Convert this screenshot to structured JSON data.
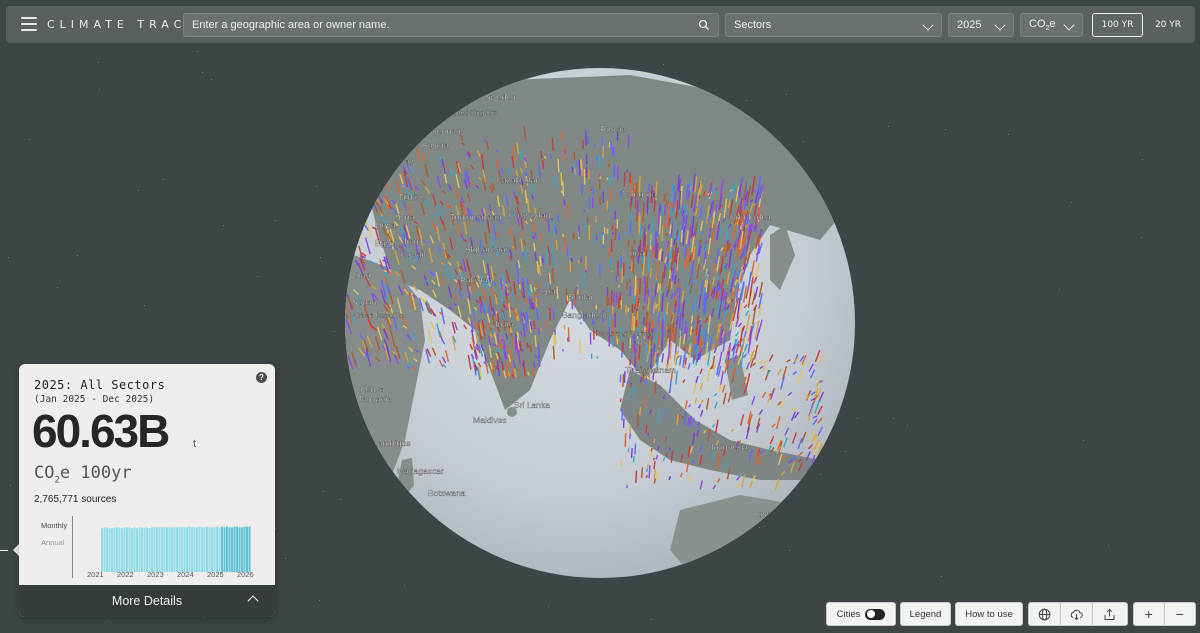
{
  "header": {
    "brand": "CLIMATE TRACE",
    "search_placeholder": "Enter a geographic area or owner name.",
    "sector_select": "Sectors",
    "year_select": "2025",
    "gas_select_prefix": "CO",
    "gas_select_sub": "2",
    "gas_select_suffix": "e",
    "gwp_100": "100 YR",
    "gwp_20": "20 YR",
    "gwp_active": "100 YR"
  },
  "map_labels": [
    {
      "text": "Sweden"
    },
    {
      "text": "United Kingdom"
    },
    {
      "text": "Russia"
    },
    {
      "text": "Germany"
    },
    {
      "text": "Austria"
    },
    {
      "text": "Italy"
    },
    {
      "text": "Kazakhstan"
    },
    {
      "text": "Mongolia"
    },
    {
      "text": "Türkiye"
    },
    {
      "text": "Syria"
    },
    {
      "text": "Turkmenistan"
    },
    {
      "text": "Kyrgyzstan"
    },
    {
      "text": "Libya"
    },
    {
      "text": "Iraq"
    },
    {
      "text": "Afghanistan"
    },
    {
      "text": "North Korea"
    },
    {
      "text": "Egypt"
    },
    {
      "text": "Kuwait"
    },
    {
      "text": "China"
    },
    {
      "text": "Pakistan"
    },
    {
      "text": "Chad"
    },
    {
      "text": "Nepal"
    },
    {
      "text": "Bhutan"
    },
    {
      "text": "Sudan"
    },
    {
      "text": "Bangladesh"
    },
    {
      "text": "Central African Republic"
    },
    {
      "text": "India"
    },
    {
      "text": "Myanmar (Burma)"
    },
    {
      "text": "Laos"
    },
    {
      "text": "Thailand"
    },
    {
      "text": "Vietnam"
    },
    {
      "text": "Kenya"
    },
    {
      "text": "Sri Lanka"
    },
    {
      "text": "Tanzania"
    },
    {
      "text": "Maldives"
    },
    {
      "text": "Mozambique"
    },
    {
      "text": "Indonesia"
    },
    {
      "text": "Madagascar"
    },
    {
      "text": "Australia"
    },
    {
      "text": "Botswana"
    }
  ],
  "summary": {
    "title": "2025: All Sectors",
    "range": "(Jan 2025 - Dec 2025)",
    "total": "60.63B",
    "unit": "t",
    "gas_prefix": "CO",
    "gas_sub": "2",
    "gas_suffix": "e 100yr",
    "sources": "2,765,771 sources",
    "toggle_monthly": "Monthly",
    "toggle_annual": "Annual",
    "more_details": "More Details"
  },
  "chart_data": {
    "type": "bar",
    "x_tick_labels": [
      "2021",
      "2022",
      "2023",
      "2024",
      "2025",
      "2026"
    ],
    "series": [
      {
        "values": [
          4.9,
          5.0,
          5.0,
          4.9,
          4.9,
          5.0,
          5.0,
          5.0,
          4.9,
          5.0,
          5.0,
          5.0,
          4.9,
          5.0,
          4.9,
          5.0,
          5.0,
          5.0,
          5.0,
          4.9,
          5.0,
          5.0,
          5.0,
          5.0,
          5.0,
          5.0,
          5.0,
          5.0,
          5.0,
          5.0,
          5.0,
          5.0,
          5.0,
          5.0,
          5.0,
          5.1,
          5.0,
          5.0,
          5.0,
          5.1,
          5.0,
          5.0,
          5.1,
          5.0,
          5.0,
          5.0,
          5.1,
          5.0,
          5.1,
          5.0,
          5.1,
          5.0,
          5.0,
          5.1,
          5.1,
          5.0,
          5.0,
          5.1,
          5.1,
          5.1
        ]
      }
    ],
    "highlight_year": "2025",
    "bar_color": "#8fdbe8",
    "highlight_color": "#5cc3d6"
  },
  "controls": {
    "cities": "Cities",
    "legend": "Legend",
    "how_to_use": "How to use",
    "zoom_in": "+",
    "zoom_out": "−"
  }
}
